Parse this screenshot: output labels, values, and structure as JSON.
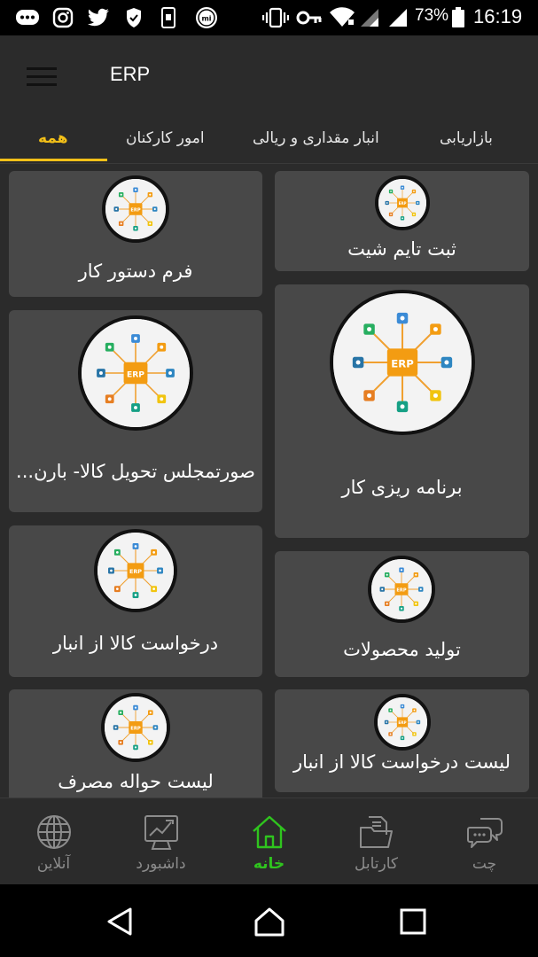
{
  "status_bar": {
    "battery_percent": "73%",
    "time": "16:19",
    "left_icons": [
      "chat-bubble-icon",
      "instagram-icon",
      "twitter-icon",
      "shield-icon",
      "phone-icon",
      "mi-icon"
    ],
    "right_icons": [
      "vibrate-icon",
      "key-icon",
      "wifi-icon",
      "signal-icon",
      "signal-icon",
      "battery-icon"
    ]
  },
  "app_bar": {
    "title": "ERP",
    "menu_icon": "hamburger-icon"
  },
  "tabs": [
    {
      "label": "همه",
      "active": true
    },
    {
      "label": "امور کارکنان",
      "active": false
    },
    {
      "label": "انبار مقداری و ریالی",
      "active": false
    },
    {
      "label": "بازاریابی",
      "active": false
    }
  ],
  "tiles": [
    {
      "label": "ثبت تایم شیت",
      "icon": "erp-logo-icon"
    },
    {
      "label": "فرم دستور کار",
      "icon": "erp-logo-icon"
    },
    {
      "label": "برنامه ریزی کار",
      "icon": "erp-logo-icon"
    },
    {
      "label": "صورتمجلس تحویل کالا- بارن...",
      "icon": "erp-logo-icon"
    },
    {
      "label": "تولید محصولات",
      "icon": "erp-logo-icon"
    },
    {
      "label": "درخواست کالا از انبار",
      "icon": "erp-logo-icon"
    },
    {
      "label": "لیست درخواست کالا از انبار",
      "icon": "erp-logo-icon"
    },
    {
      "label": "لیست حواله مصرف",
      "icon": "erp-logo-icon"
    }
  ],
  "bottom_nav": [
    {
      "label": "آنلاین",
      "icon": "globe-icon",
      "active": false
    },
    {
      "label": "داشبورد",
      "icon": "dashboard-icon",
      "active": false
    },
    {
      "label": "خانه",
      "icon": "home-icon",
      "active": true
    },
    {
      "label": "کارتابل",
      "icon": "folder-icon",
      "active": false
    },
    {
      "label": "چت",
      "icon": "chat-icon",
      "active": false
    }
  ],
  "system_nav": [
    "back-icon",
    "home-circle-icon",
    "recents-icon"
  ],
  "colors": {
    "accent": "#f3c018",
    "active_nav": "#2fc41e",
    "card": "#484848",
    "background": "#2b2b2b"
  }
}
